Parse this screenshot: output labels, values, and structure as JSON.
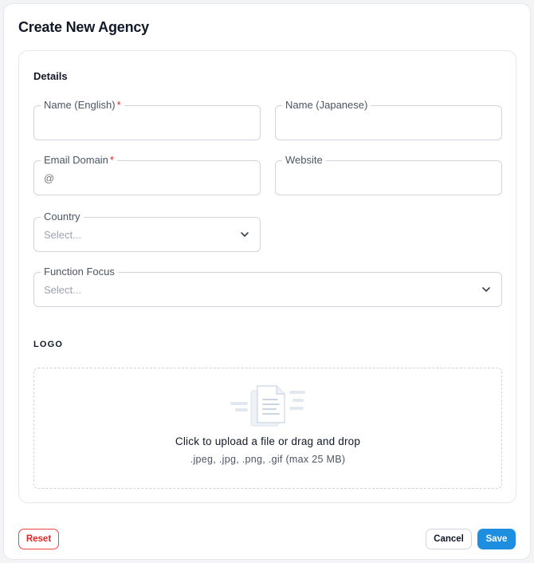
{
  "dialog": {
    "title": "Create New Agency"
  },
  "details": {
    "section_title": "Details",
    "name_en": {
      "label": "Name (English)",
      "required_mark": "*",
      "value": ""
    },
    "name_ja": {
      "label": "Name (Japanese)",
      "value": ""
    },
    "email_domain": {
      "label": "Email Domain",
      "required_mark": "*",
      "placeholder": "@"
    },
    "website": {
      "label": "Website",
      "value": ""
    },
    "country": {
      "label": "Country",
      "placeholder": "Select..."
    },
    "function_focus": {
      "label": "Function Focus",
      "placeholder": "Select..."
    }
  },
  "logo": {
    "section_title": "LOGO",
    "upload_text": "Click to upload a file or drag and drop",
    "formats_text": ".jpeg, .jpg, .png, .gif (max 25 MB)",
    "illustration_icon": "document-upload-icon"
  },
  "footer": {
    "reset_label": "Reset",
    "cancel_label": "Cancel",
    "save_label": "Save"
  },
  "colors": {
    "primary": "#1e8ee0",
    "danger": "#dc2626",
    "border": "#d1d5db"
  }
}
